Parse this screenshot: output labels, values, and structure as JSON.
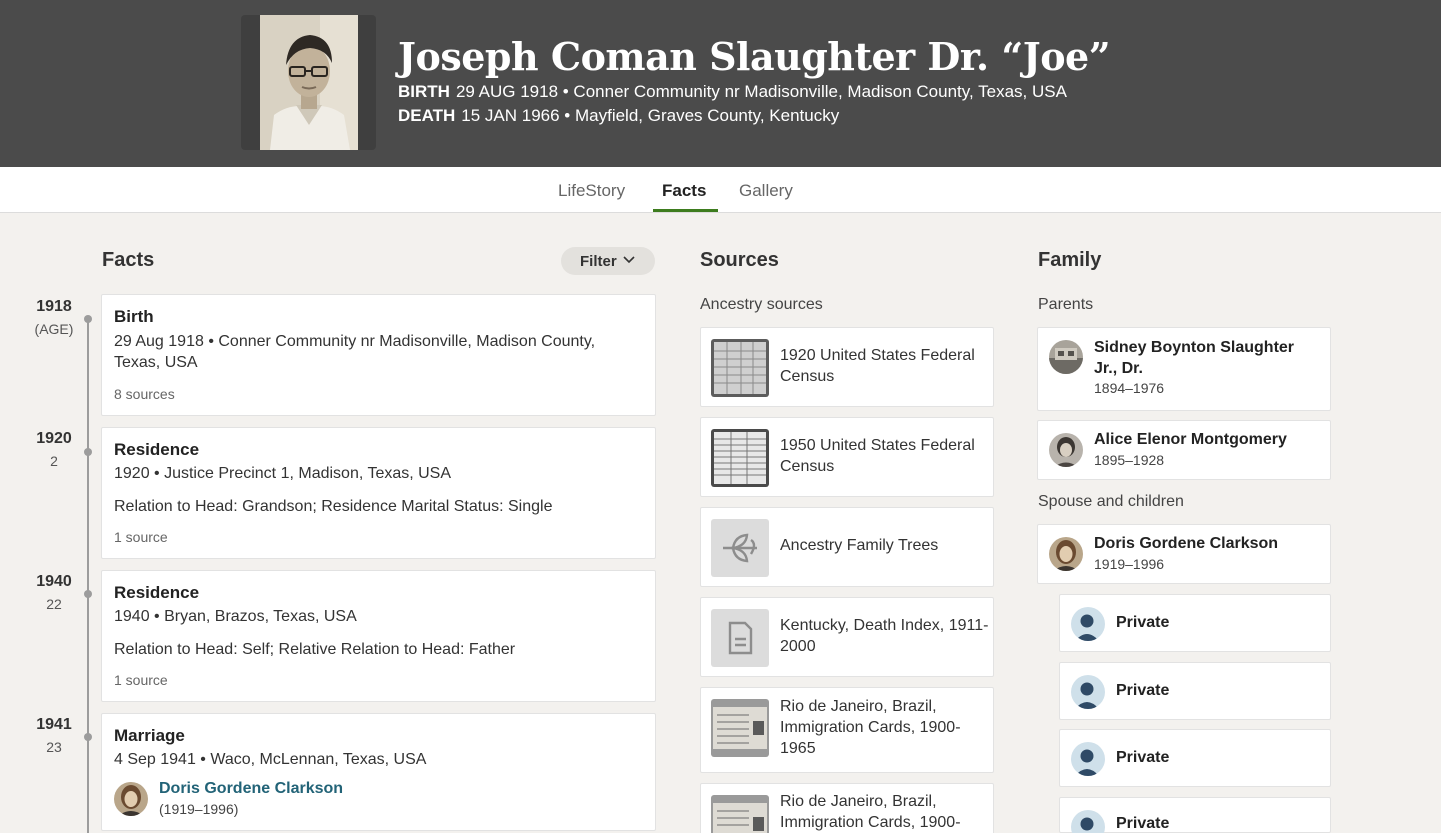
{
  "person": {
    "name": "Joseph Coman Slaughter Dr. “Joe”",
    "birth_label": "BIRTH",
    "birth_value": "29 AUG 1918 • Conner Community nr Madisonville, Madison County, Texas, USA",
    "death_label": "DEATH",
    "death_value": "15 JAN 1966 • Mayfield, Graves County, Kentucky"
  },
  "tabs": [
    {
      "label": "LifeStory"
    },
    {
      "label": "Facts"
    },
    {
      "label": "Gallery"
    }
  ],
  "facts": {
    "title": "Facts",
    "filter_label": "Filter",
    "timeline": [
      {
        "year": "1918",
        "age": "(AGE)"
      },
      {
        "year": "1920",
        "age": "2"
      },
      {
        "year": "1940",
        "age": "22"
      },
      {
        "year": "1941",
        "age": "23"
      }
    ],
    "items": [
      {
        "title": "Birth",
        "line1": "29 Aug 1918 • Conner Community nr Madisonville, Madison County, Texas, USA",
        "sources": "8 sources"
      },
      {
        "title": "Residence",
        "line1": "1920 • Justice Precinct 1, Madison, Texas, USA",
        "detail": "Relation to Head: Grandson; Residence Marital Status: Single",
        "sources": "1 source"
      },
      {
        "title": "Residence",
        "line1": "1940 • Bryan, Brazos, Texas, USA",
        "detail": "Relation to Head: Self; Relative Relation to Head: Father",
        "sources": "1 source"
      },
      {
        "title": "Marriage",
        "line1": "4 Sep 1941 • Waco, McLennan, Texas, USA",
        "spouse_name": "Doris Gordene Clarkson",
        "spouse_years": "(1919–1996)"
      }
    ]
  },
  "sources": {
    "title": "Sources",
    "subtitle": "Ancestry sources",
    "items": [
      {
        "label": "1920 United States Federal Census",
        "icon": "census-document-thumbnail"
      },
      {
        "label": "1950 United States Federal Census",
        "icon": "census-document-thumbnail"
      },
      {
        "label": "Ancestry Family Trees",
        "icon": "leaf-icon"
      },
      {
        "label": "Kentucky, Death Index, 1911-2000",
        "icon": "document-icon"
      },
      {
        "label": "Rio de Janeiro, Brazil, Immigration Cards, 1900-1965",
        "icon": "immigration-card-thumbnail"
      },
      {
        "label": "Rio de Janeiro, Brazil, Immigration Cards, 1900-",
        "icon": "immigration-card-thumbnail"
      }
    ]
  },
  "family": {
    "title": "Family",
    "parents_label": "Parents",
    "parents": [
      {
        "name": "Sidney Boynton Slaughter Jr., Dr.",
        "years": "1894–1976"
      },
      {
        "name": "Alice Elenor Montgomery",
        "years": "1895–1928"
      }
    ],
    "spouse_label": "Spouse and children",
    "spouse": {
      "name": "Doris Gordene Clarkson",
      "years": "1919–1996"
    },
    "children": [
      {
        "name": "Private"
      },
      {
        "name": "Private"
      },
      {
        "name": "Private"
      },
      {
        "name": "Private"
      }
    ]
  },
  "colors": {
    "header_bg": "#4b4b4b",
    "page_bg": "#f3f1ee",
    "tab_accent": "#3d7c1e",
    "link": "#226377"
  }
}
